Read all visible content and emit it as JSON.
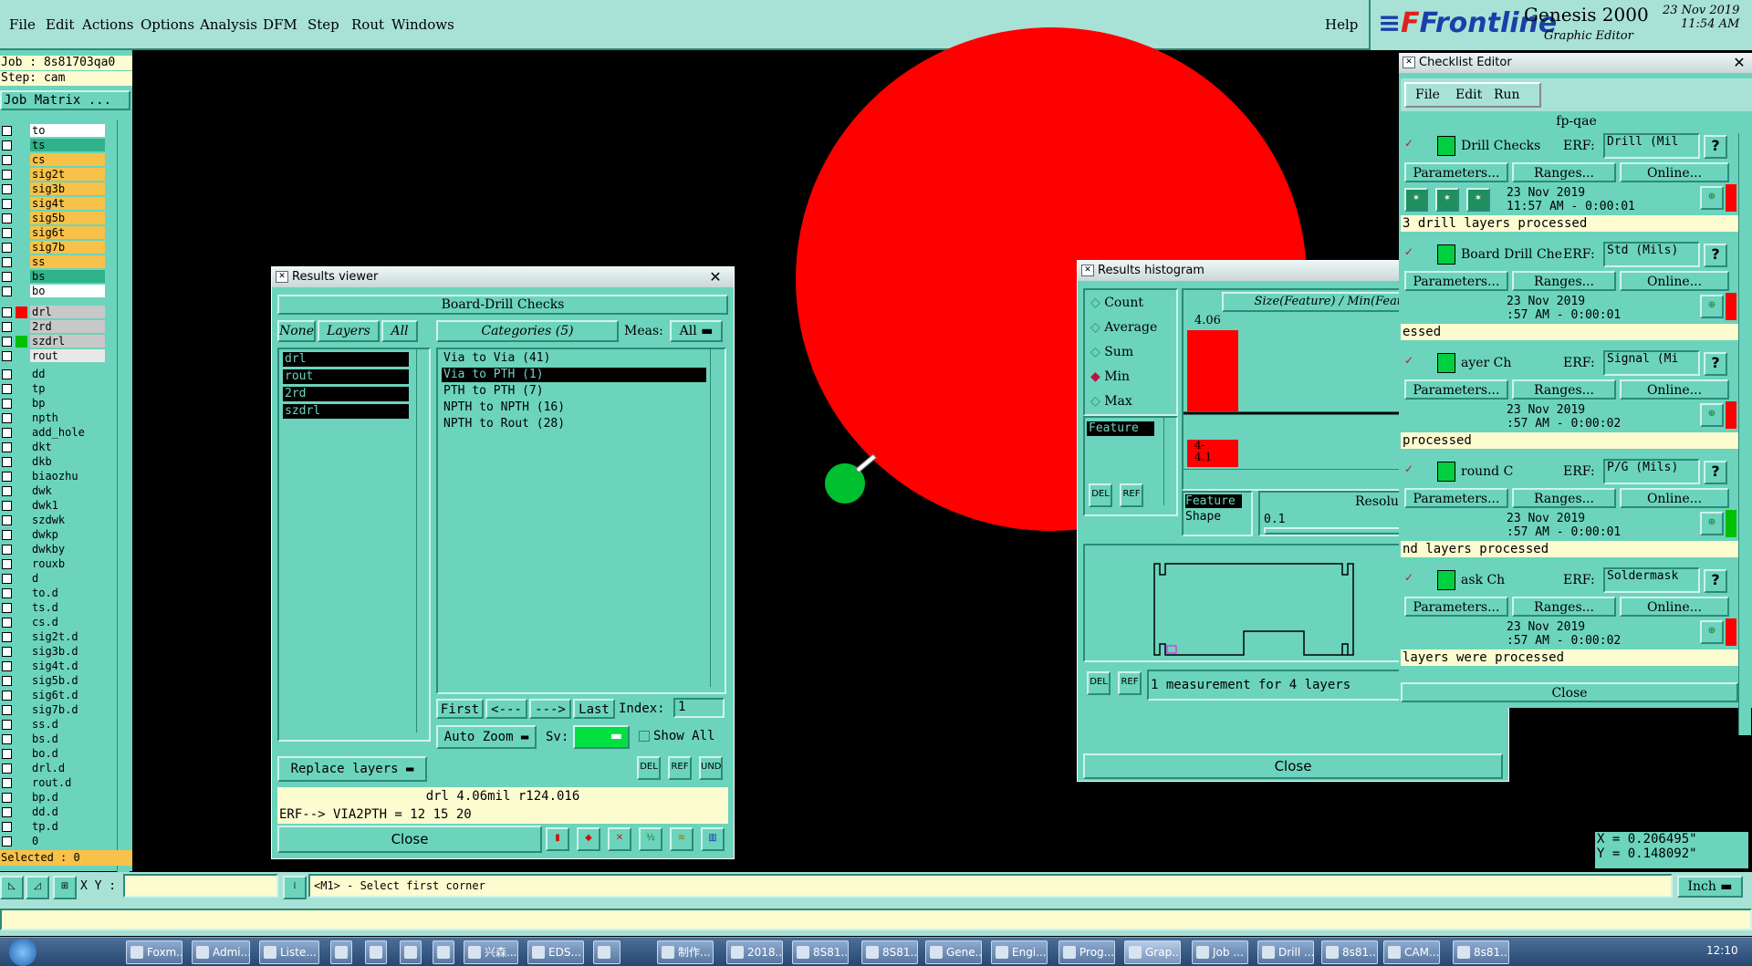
{
  "menu": [
    "File",
    "Edit",
    "Actions",
    "Options",
    "Analysis",
    "DFM",
    "Step",
    "Rout",
    "Windows"
  ],
  "help": "Help",
  "brand": {
    "logo": "Frontline",
    "product": "Genesis 2000",
    "subtitle": "Graphic Editor",
    "date": "23 Nov 2019",
    "time": "11:54 AM"
  },
  "left": {
    "job": "Job : 8s81703qa0",
    "step": "Step: cam",
    "job_matrix": "Job Matrix ...",
    "selected": "Selected : 0",
    "layers": [
      {
        "n": "to",
        "c": "#ffffff"
      },
      {
        "n": "ts",
        "c": "#2fb28a"
      },
      {
        "n": "cs",
        "c": "#f7c24a"
      },
      {
        "n": "sig2t",
        "c": "#f7c24a"
      },
      {
        "n": "sig3b",
        "c": "#f7c24a"
      },
      {
        "n": "sig4t",
        "c": "#f7c24a"
      },
      {
        "n": "sig5b",
        "c": "#f7c24a"
      },
      {
        "n": "sig6t",
        "c": "#f7c24a"
      },
      {
        "n": "sig7b",
        "c": "#f7c24a"
      },
      {
        "n": "ss",
        "c": "#f7c24a"
      },
      {
        "n": "bs",
        "c": "#2fb28a"
      },
      {
        "n": "bo",
        "c": "#ffffff"
      }
    ],
    "drill_layers": [
      {
        "n": "drl",
        "c": "#c8c8c8",
        "sw": "#ff0000"
      },
      {
        "n": "2rd",
        "c": "#c8c8c8",
        "sw": ""
      },
      {
        "n": "szdrl",
        "c": "#c8c8c8",
        "sw": "#00c000"
      },
      {
        "n": "rout",
        "c": "#e8e8e8",
        "sw": ""
      }
    ],
    "misc_layers": [
      "dd",
      "tp",
      "bp",
      "npth",
      "add_hole",
      "dkt",
      "dkb",
      "biaozhu",
      "dwk",
      "dwk1",
      "szdwk",
      "dwkp",
      "dwkby",
      "rouxb",
      "d",
      "to.d",
      "ts.d",
      "cs.d",
      "sig2t.d",
      "sig3b.d",
      "sig4t.d",
      "sig5b.d",
      "sig6t.d",
      "sig7b.d",
      "ss.d",
      "bs.d",
      "bo.d",
      "drl.d",
      "rout.d",
      "bp.d",
      "dd.d",
      "tp.d",
      "0"
    ]
  },
  "rv": {
    "title": "Results viewer",
    "header": "Board-Drill Checks",
    "none": "None",
    "layers": "Layers",
    "all": "All",
    "categories": "Categories (5)",
    "meas_label": "Meas:",
    "meas_val": "All",
    "layer_list": [
      "drl",
      "rout",
      "2rd",
      "szdrl"
    ],
    "cat_list": [
      "Via to Via  (41)",
      "Via to PTH  (1)",
      "PTH to PTH  (7)",
      "NPTH to NPTH  (16)",
      "NPTH to Rout  (28)"
    ],
    "first": "First",
    "prev": "<---",
    "next": "--->",
    "last": "Last",
    "index_label": "Index:",
    "index_val": "1",
    "auto_zoom": "Auto Zoom",
    "sv": "Sv:",
    "show_all": "Show All",
    "replace": "Replace layers",
    "status1": "drl 4.06mil  r124.016",
    "status2": "ERF--> VIA2PTH = 12 15 20",
    "close": "Close"
  },
  "hist": {
    "title": "Results histogram",
    "radios": [
      "Count",
      "Average",
      "Sum",
      "Min",
      "Max"
    ],
    "selected_radio": "Min",
    "feature": "Feature",
    "chart_title": "Size(Feature) / Min(Feature)",
    "bar_label": "4.06",
    "range_label1": "4-",
    "range_label2": "4.1",
    "feature2": "Feature",
    "shape": "Shape",
    "resolution": "Resolution",
    "res_val": "0.1",
    "measure": "1 measurement for 4 layers",
    "close": "Close"
  },
  "chart_data": {
    "type": "bar",
    "categories": [
      "4-4.1"
    ],
    "values": [
      1
    ],
    "title": "Size(Feature) / Min(Feature)",
    "bar_value_label": "4.06"
  },
  "ce": {
    "title": "Checklist Editor",
    "menu": [
      "File",
      "Edit",
      "Run"
    ],
    "list_name": "fp-qae",
    "checks": [
      {
        "name": "Drill Checks",
        "erf": "Drill (Mil",
        "date": "23 Nov 2019",
        "time": "11:57 AM - 0:00:01",
        "msg": "3 drill layers processed",
        "status": "#ff0000"
      },
      {
        "name": "Board Drill Che",
        "erf": "Std (Mils)",
        "date": "23 Nov 2019",
        "time": ":57 AM - 0:00:01",
        "msg": "essed",
        "status": "#ff0000"
      },
      {
        "name": "ayer Ch",
        "erf": "Signal (Mi",
        "date": "23 Nov 2019",
        "time": ":57 AM - 0:00:02",
        "msg": " processed",
        "status": "#ff0000"
      },
      {
        "name": "round C",
        "erf": "P/G (Mils)",
        "date": "23 Nov 2019",
        "time": ":57 AM - 0:00:01",
        "msg": "nd layers processed",
        "status": "#00c000"
      },
      {
        "name": "ask Ch",
        "erf": "Soldermask",
        "date": "23 Nov 2019",
        "time": ":57 AM - 0:00:02",
        "msg": " layers were processed",
        "status": "#ff0000"
      }
    ],
    "erf_label": "ERF:",
    "params": "Parameters...",
    "ranges": "Ranges...",
    "online": "Online...",
    "close": "Close"
  },
  "coords": {
    "x": "X = 0.206495\"",
    "y": "Y = 0.148092\""
  },
  "bottom": {
    "xy": "X Y :",
    "prompt": "<M1> - Select first corner",
    "units": "Inch"
  },
  "taskbar": {
    "items": [
      "Foxm...",
      "Admi...",
      "Liste...",
      "",
      "",
      "",
      "",
      "兴森...",
      "EDS...",
      "",
      "制作...",
      "2018...",
      "8S81...",
      "8S81...",
      "Gene...",
      "Engi...",
      "Prog...",
      "Grap...",
      "Job ...",
      "Drill ...",
      "8s81...",
      "CAM...",
      "8s81..."
    ],
    "clock": "12:10"
  }
}
